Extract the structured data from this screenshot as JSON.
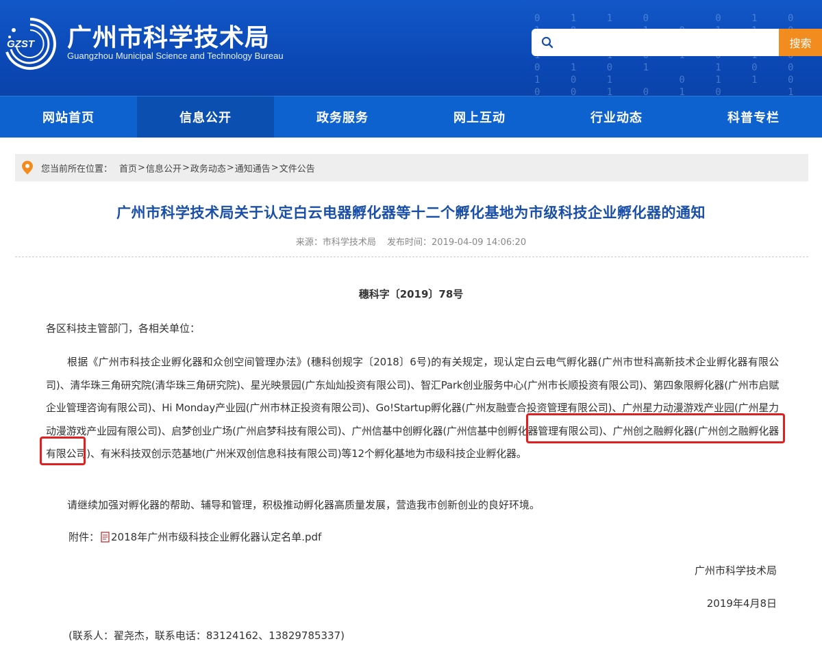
{
  "header": {
    "logo_abbr": "GZST",
    "logo_cn": "广州市科学技术局",
    "logo_en": "Guangzhou Municipal Science and Technology Bureau",
    "search_placeholder": "",
    "search_button": "搜索"
  },
  "nav": {
    "items": [
      {
        "label": "网站首页"
      },
      {
        "label": "信息公开"
      },
      {
        "label": "政务服务"
      },
      {
        "label": "网上互动"
      },
      {
        "label": "行业动态"
      },
      {
        "label": "科普专栏"
      }
    ],
    "active": "信息公开"
  },
  "breadcrumb": {
    "prefix": "您当前所在位置：",
    "items": [
      "首页",
      "信息公开",
      "政务动态",
      "通知通告",
      "文件公告"
    ],
    "separator": ">"
  },
  "article": {
    "title": "广州市科学技术局关于认定白云电器孵化器等十二个孵化基地为市级科技企业孵化器的通知",
    "source_label": "来源：市科学技术局",
    "publish_label": "发布时间：2019-04-09 14:06:20",
    "doc_number": "穗科字〔2019〕78号",
    "salutation": "各区科技主管部门，各相关单位：",
    "paragraph1": "根据《广州市科技企业孵化器和众创空间管理办法》(穗科创规字〔2018〕6号)的有关规定，现认定白云电气孵化器(广州市世科高新技术企业孵化器有限公司)、清华珠三角研究院(清华珠三角研究院)、星光映景园(广东灿灿投资有限公司)、智汇Park创业服务中心(广州市长顺投资有限公司)、第四象限孵化器(广州市启赋企业管理咨询有限公司)、Hi Monday产业园(广州市林正投资有限公司)、Go!Startup孵化器(广州友融壹合投资管理有限公司)、广州星力动漫游戏产业园(广州星力动漫游戏产业园有限公司)、启梦创业广场(广州启梦科技有限公司)、广州信基中创孵化器(广州信基中创孵化器管理有限公司)、广州创之融孵化器(广州创之融孵化器有限公司)、有米科技双创示范基地(广州米双创信息科技有限公司)等12个孵化基地为市级科技企业孵化器。",
    "paragraph2": "请继续加强对孵化器的帮助、辅导和管理，积极推动孵化器高质量发展，营造我市创新创业的良好环境。",
    "attachment_label": "附件：",
    "attachment_file": "2018年广州市级科技企业孵化器认定名单.pdf",
    "sign_org": "广州市科学技术局",
    "sign_date": "2019年4月8日",
    "contact": "(联系人：翟尧杰，联系电话：83124162、13829785337)"
  },
  "colors": {
    "header_blue": "#0b49b6",
    "nav_blue": "#0e62cf",
    "search_orange": "#f28c1e",
    "title_blue": "#1a4fa8",
    "highlight_red": "#e02020",
    "pin_orange": "#f28c1e"
  },
  "icons": [
    "logo-icon",
    "search-icon",
    "location-pin-icon",
    "pdf-file-icon"
  ]
}
